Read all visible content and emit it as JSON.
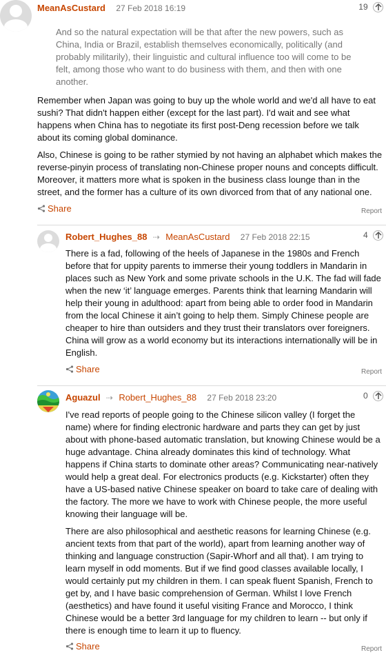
{
  "comments": [
    {
      "author": "MeanAsCustard",
      "date": "27 Feb 2018 16:19",
      "recommend_count": "19",
      "quote": "And so the natural expectation will be that after the new powers, such as China, India or Brazil, establish themselves economically, politically (and probably militarily), their linguistic and cultural influence too will come to be felt, among those who want to do business with them, and then with one another.",
      "paragraphs": [
        "Remember when Japan was going to buy up the whole world and we'd all have to eat sushi? That didn't happen either (except for the last part). I'd wait and see what happens when China has to negotiate its first post-Deng recession before we talk about its coming global dominance.",
        "Also, Chinese is going to be rather stymied by not having an alphabet which makes the reverse-pinyin process of translating non-Chinese proper nouns and concepts difficult. Moreover, it matters more what is spoken in the business class lounge than in the street, and the former has a culture of its own divorced from that of any national one."
      ],
      "share_label": "Share",
      "report_label": "Report"
    },
    {
      "author": "Robert_Hughes_88",
      "reply_to": "MeanAsCustard",
      "date": "27 Feb 2018 22:15",
      "recommend_count": "4",
      "paragraphs": [
        "There is a fad, following of the heels of Japanese in the 1980s and French before that for uppity parents to immerse their young toddlers in Mandarin in places such as New York and some private schools in the U.K. The fad will fade when the new ‘it’ language emerges. Parents think that learning Mandarin will help their young in adulthood: apart from being able to order food in Mandarin from the local Chinese it ain’t going to help them. Simply Chinese people are cheaper to hire than outsiders and they trust their translators over foreigners. China will grow as a world economy but its interactions internationally will be in English."
      ],
      "share_label": "Share",
      "report_label": "Report"
    },
    {
      "author": "Aguazul",
      "reply_to": "Robert_Hughes_88",
      "date": "27 Feb 2018 23:20",
      "recommend_count": "0",
      "paragraphs": [
        "I've read reports of people going to the Chinese silicon valley (I forget the name) where for finding electronic hardware and parts they can get by just about with phone-based automatic translation, but knowing Chinese would be a huge advantage. China already dominates this kind of technology. What happens if China starts to dominate other areas? Communicating near-natively would help a great deal. For electronics products (e.g. Kickstarter) often they have a US-based native Chinese speaker on board to take care of dealing with the factory. The more we have to work with Chinese people, the more useful knowing their language will be.",
        "There are also philosophical and aesthetic reasons for learning Chinese (e.g. ancient texts from that part of the world), apart from learning another way of thinking and language construction (Sapir-Whorf and all that). I am trying to learn myself in odd moments. But if we find good classes available locally, I would certainly put my children in them. I can speak fluent Spanish, French to get by, and I have basic comprehension of German. Whilst I love French (aesthetics) and have found it useful visiting France and Morocco, I think Chinese would be a better 3rd language for my children to learn -- but only if there is enough time to learn it up to fluency."
      ],
      "share_label": "Share",
      "report_label": "Report"
    }
  ],
  "icons": {
    "reply": "reply-arrow-icon",
    "recommend": "up-arrow-icon",
    "share": "share-icon",
    "default_avatar": "user-silhouette-icon",
    "custom_avatar": "aguazul-avatar-icon"
  },
  "colors": {
    "author": "#c74600",
    "share": "#c74600",
    "meta": "#767676",
    "quote_text": "#767676",
    "body_text": "#121212",
    "divider": "#dcdcdc"
  }
}
